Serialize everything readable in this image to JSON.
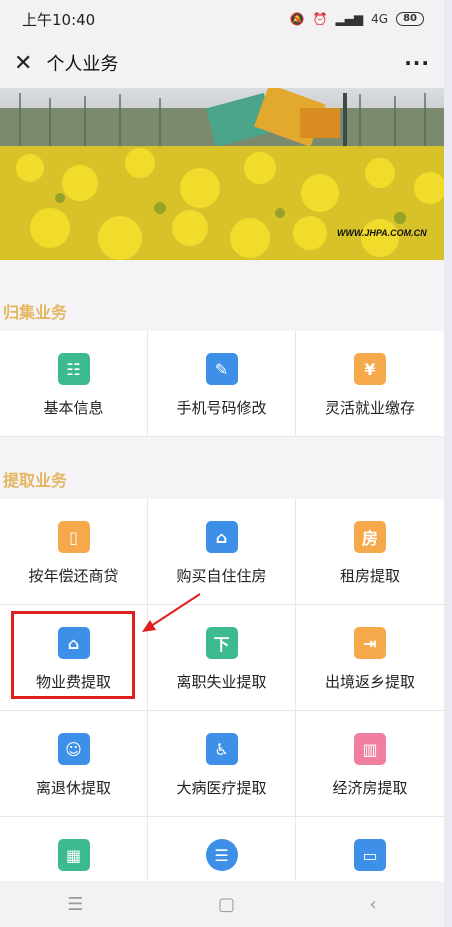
{
  "status": {
    "time": "上午10:40",
    "network": "4G",
    "battery": "80"
  },
  "header": {
    "title": "个人业务"
  },
  "banner": {
    "watermark": "WWW.JHPA.COM.CN"
  },
  "sections": [
    {
      "title": "归集业务",
      "items": [
        {
          "label": "基本信息",
          "icon": "id-card-icon",
          "color": "#3dbb8e",
          "glyph": "☷"
        },
        {
          "label": "手机号码修改",
          "icon": "pencil-icon",
          "color": "#3d8fe8",
          "glyph": "✎"
        },
        {
          "label": "灵活就业缴存",
          "icon": "yen-icon",
          "color": "#f5a94a",
          "glyph": "¥"
        }
      ]
    },
    {
      "title": "提取业务",
      "items": [
        {
          "label": "按年偿还商贷",
          "icon": "clipboard-icon",
          "color": "#f5a94a",
          "glyph": "▯"
        },
        {
          "label": "购买自住住房",
          "icon": "house-icon",
          "color": "#3d8fe8",
          "glyph": "⌂"
        },
        {
          "label": "租房提取",
          "icon": "rent-house-icon",
          "color": "#f5a94a",
          "glyph": "房"
        },
        {
          "label": "物业费提取",
          "icon": "property-fee-icon",
          "color": "#3d8fe8",
          "glyph": "⌂"
        },
        {
          "label": "离职失业提取",
          "icon": "resign-icon",
          "color": "#3dbb8e",
          "glyph": "下"
        },
        {
          "label": "出境返乡提取",
          "icon": "exit-icon",
          "color": "#f5a94a",
          "glyph": "⇥"
        },
        {
          "label": "离退休提取",
          "icon": "retire-icon",
          "color": "#3d8fe8",
          "glyph": "☺"
        },
        {
          "label": "大病医疗提取",
          "icon": "medical-icon",
          "color": "#3d8fe8",
          "glyph": "♿"
        },
        {
          "label": "经济房提取",
          "icon": "economic-house-icon",
          "color": "#f07fa0",
          "glyph": "▥"
        },
        {
          "label": "",
          "icon": "apps-icon",
          "color": "#3dbb8e",
          "glyph": "▦"
        },
        {
          "label": "",
          "icon": "list-icon",
          "color": "#3d8fe8",
          "glyph": "☰"
        },
        {
          "label": "",
          "icon": "card-icon",
          "color": "#3d8fe8",
          "glyph": "▭"
        }
      ]
    }
  ]
}
